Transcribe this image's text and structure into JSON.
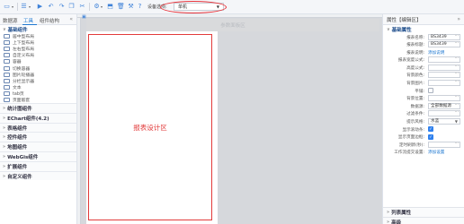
{
  "toolbar": {
    "device_label": "设备选项:",
    "device_value": "单机",
    "accent": "#3f82d8"
  },
  "left_panel": {
    "tabs": [
      "数据源",
      "工具",
      "组件结构"
    ],
    "basic_section": "基础组件",
    "basic_items": [
      "居中型布局",
      "上下型布局",
      "左右型布局",
      "自定义布局",
      "容器",
      "切换容器",
      "图片轮播器",
      "分栏显示器",
      "文本",
      "tab页",
      "页面嵌套"
    ],
    "groups": [
      "统计图组件",
      "EChart组件(4.2)",
      "表格组件",
      "控件组件",
      "地图组件",
      "WebGis组件",
      "扩展组件",
      "自定义组件"
    ]
  },
  "canvas": {
    "page_title": "参数面板区",
    "design_label": "报表设计区",
    "design_border": "#e23b3b"
  },
  "right_panel": {
    "title": "属性【编辑区】",
    "section": "基础属性",
    "props": [
      {
        "label": "报表名称:",
        "type": "input",
        "value": "BS3439"
      },
      {
        "label": "报表标题:",
        "type": "input",
        "value": "BS3439"
      },
      {
        "label": "报表说明:",
        "type": "link",
        "value": "添加说明"
      },
      {
        "label": "报表宽度公式:",
        "type": "input",
        "value": ""
      },
      {
        "label": "高度公式:",
        "type": "input",
        "value": ""
      },
      {
        "label": "背景颜色:",
        "type": "input",
        "value": ""
      },
      {
        "label": "背景图片:",
        "type": "input",
        "value": ""
      },
      {
        "label": "平铺:",
        "type": "check",
        "value": ""
      },
      {
        "label": "背景位置:",
        "type": "input",
        "value": ""
      },
      {
        "label": "数据源:",
        "type": "input",
        "value": "全部数据源"
      },
      {
        "label": "过滤条件:",
        "type": "input",
        "value": ""
      },
      {
        "label": "提示风格:",
        "type": "select",
        "value": "水蓝"
      },
      {
        "label": "显示滚动条:",
        "type": "checkon",
        "value": ""
      },
      {
        "label": "显示页面边框:",
        "type": "checkon",
        "value": ""
      },
      {
        "label": "定时刷新(秒):",
        "type": "input",
        "value": ""
      },
      {
        "label": "工作流提交设置:",
        "type": "link",
        "value": "添加设置"
      }
    ],
    "bottom_sections": [
      "列表属性",
      "高级"
    ]
  }
}
